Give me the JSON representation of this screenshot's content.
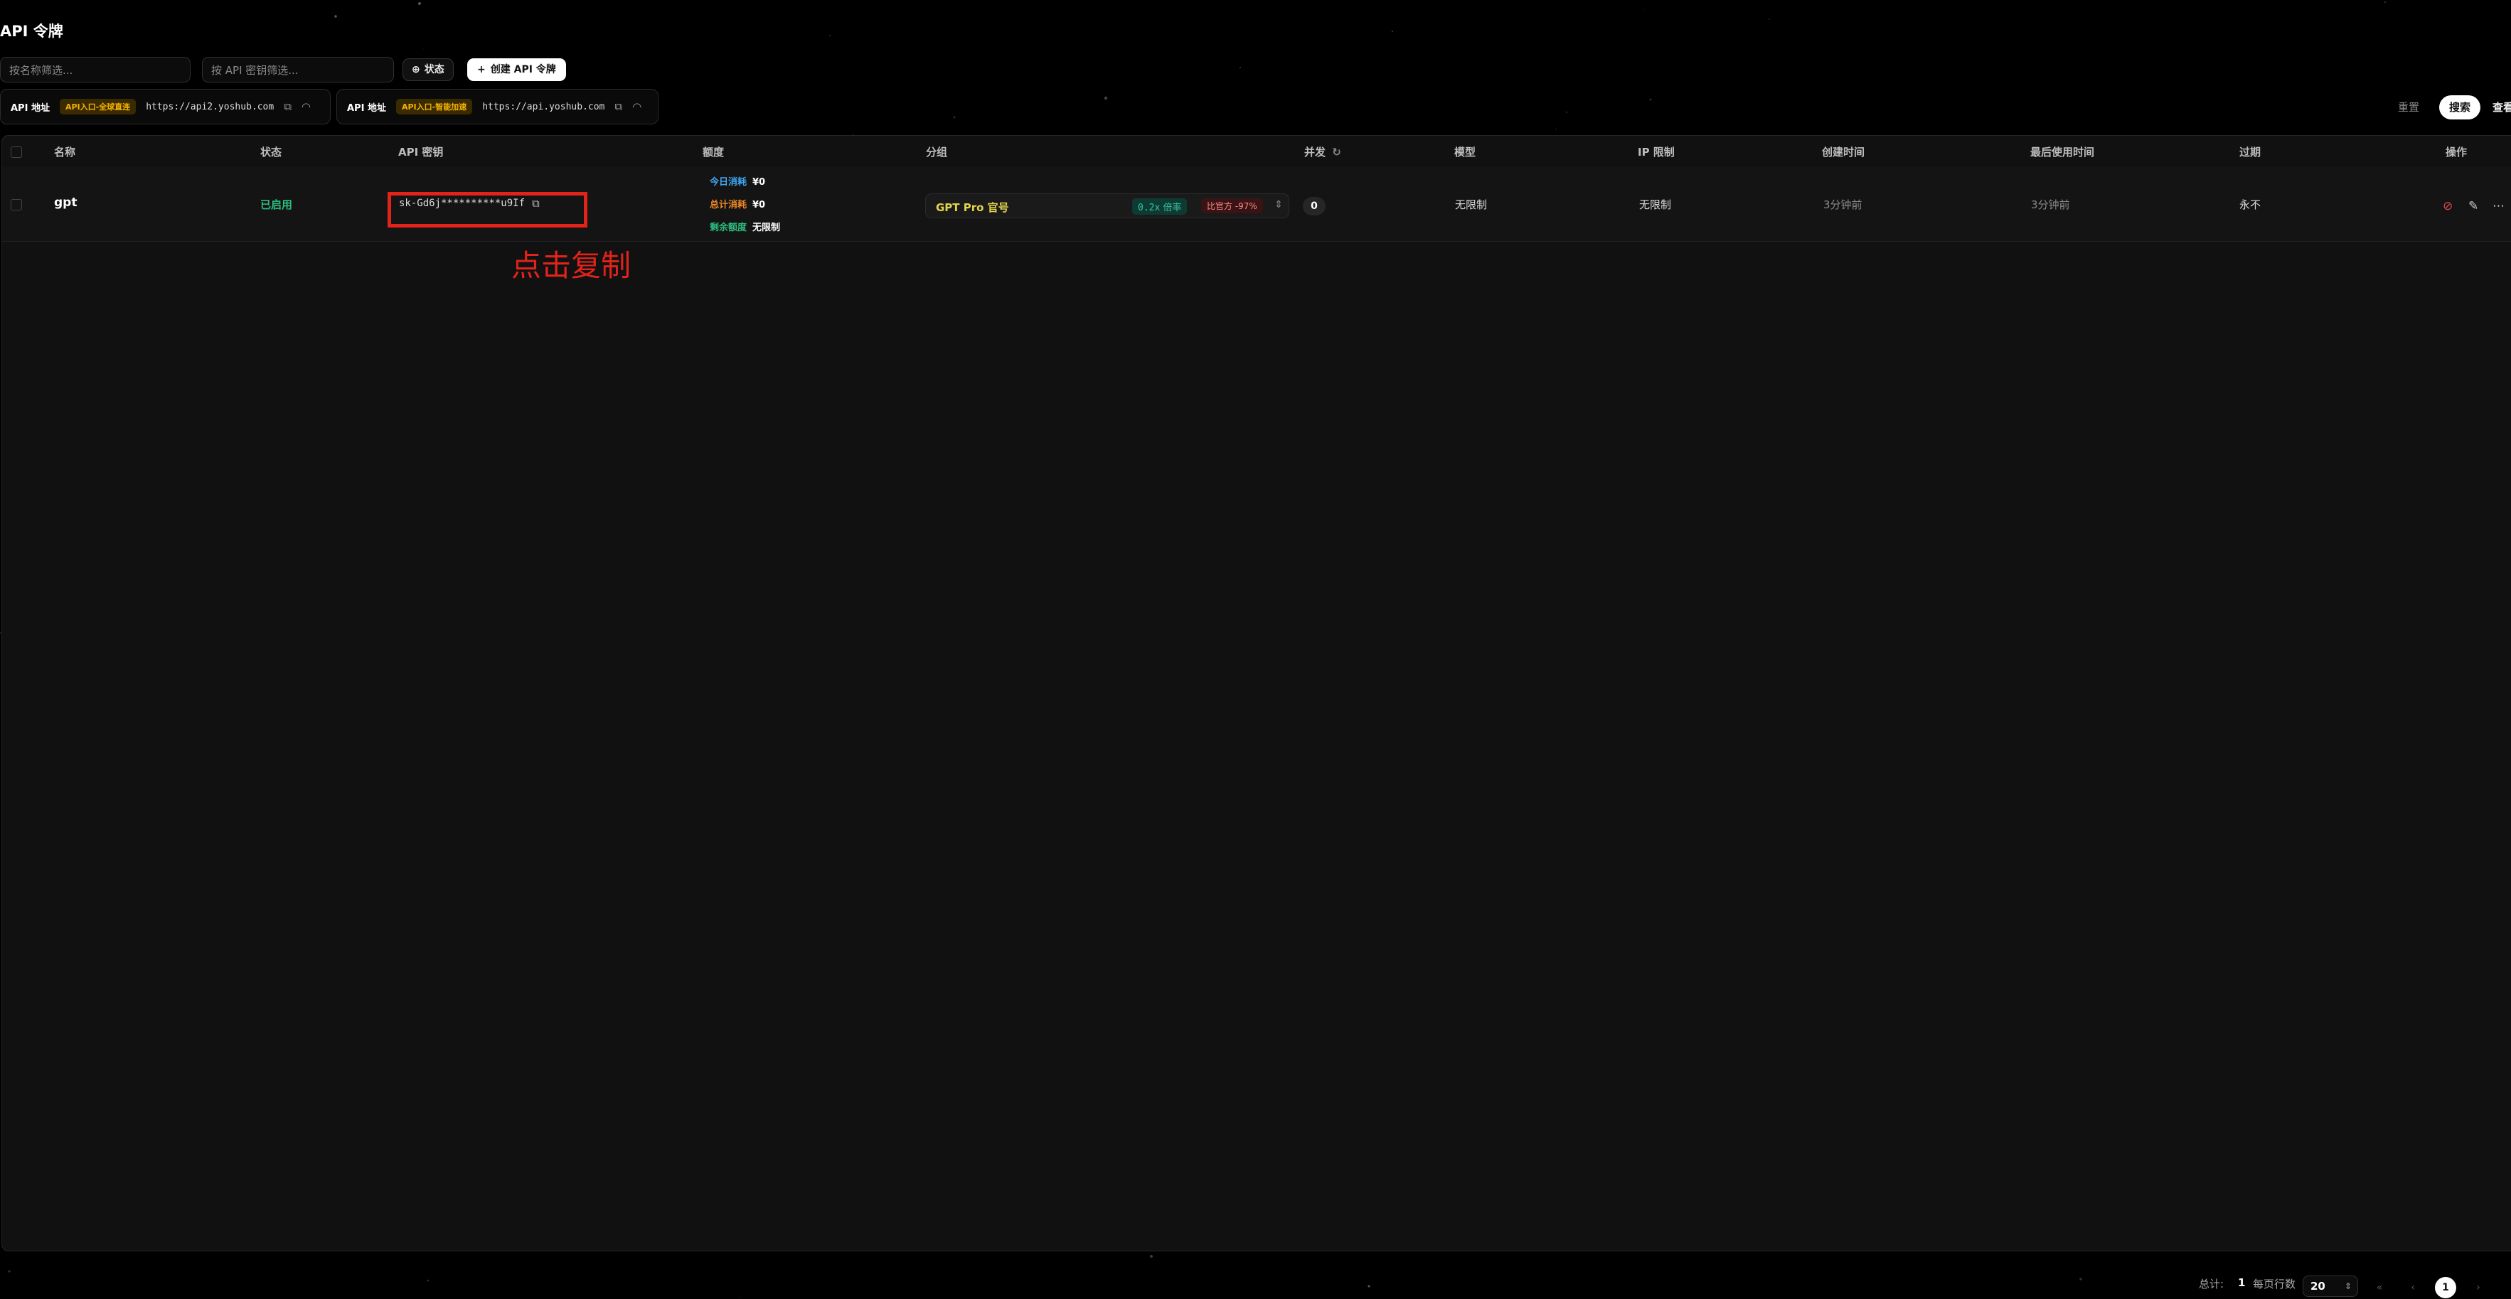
{
  "page": {
    "title": "API 令牌"
  },
  "filters": {
    "name_placeholder": "按名称筛选...",
    "key_placeholder": "按 API 密钥筛选...",
    "status_label": "状态",
    "create_label": "创建 API 令牌"
  },
  "endpoints": [
    {
      "label": "API 地址",
      "tag": "API入口-全球直连",
      "url": "https://api2.yoshub.com"
    },
    {
      "label": "API 地址",
      "tag": "API入口-智能加速",
      "url": "https://api.yoshub.com"
    }
  ],
  "actions": {
    "reset": "重置",
    "search": "搜索",
    "view": "查看"
  },
  "table": {
    "columns": [
      "名称",
      "状态",
      "API 密钥",
      "额度",
      "分组",
      "并发",
      "模型",
      "IP 限制",
      "创建时间",
      "最后使用时间",
      "过期",
      "操作"
    ],
    "rows": [
      {
        "name": "gpt",
        "status": "已启用",
        "key": "sk-Gd6j**********u9If",
        "quota": [
          {
            "label": "今日消耗",
            "value": "¥0"
          },
          {
            "label": "总计消耗",
            "value": "¥0"
          },
          {
            "label": "剩余额度",
            "value": "无限制"
          }
        ],
        "group": {
          "name": "GPT Pro 官号",
          "rate_value": "0.2x",
          "rate_label": "倍率",
          "compare": "比官方 -97%"
        },
        "concurrency": "0",
        "model": "无限制",
        "ip_limit": "无限制",
        "created": "3分钟前",
        "last_used": "3分钟前",
        "expire": "永不"
      }
    ]
  },
  "annotation": {
    "text": "点击复制",
    "color": "#e2231a"
  },
  "pagination": {
    "total_label": "总计:",
    "total": "1",
    "per_page_label": "每页行数",
    "per_page": "20",
    "current_page": "1"
  },
  "colors": {
    "enabled": "#2dbd7e",
    "annotation": "#e2231a",
    "group_name": "#e3d44b"
  }
}
